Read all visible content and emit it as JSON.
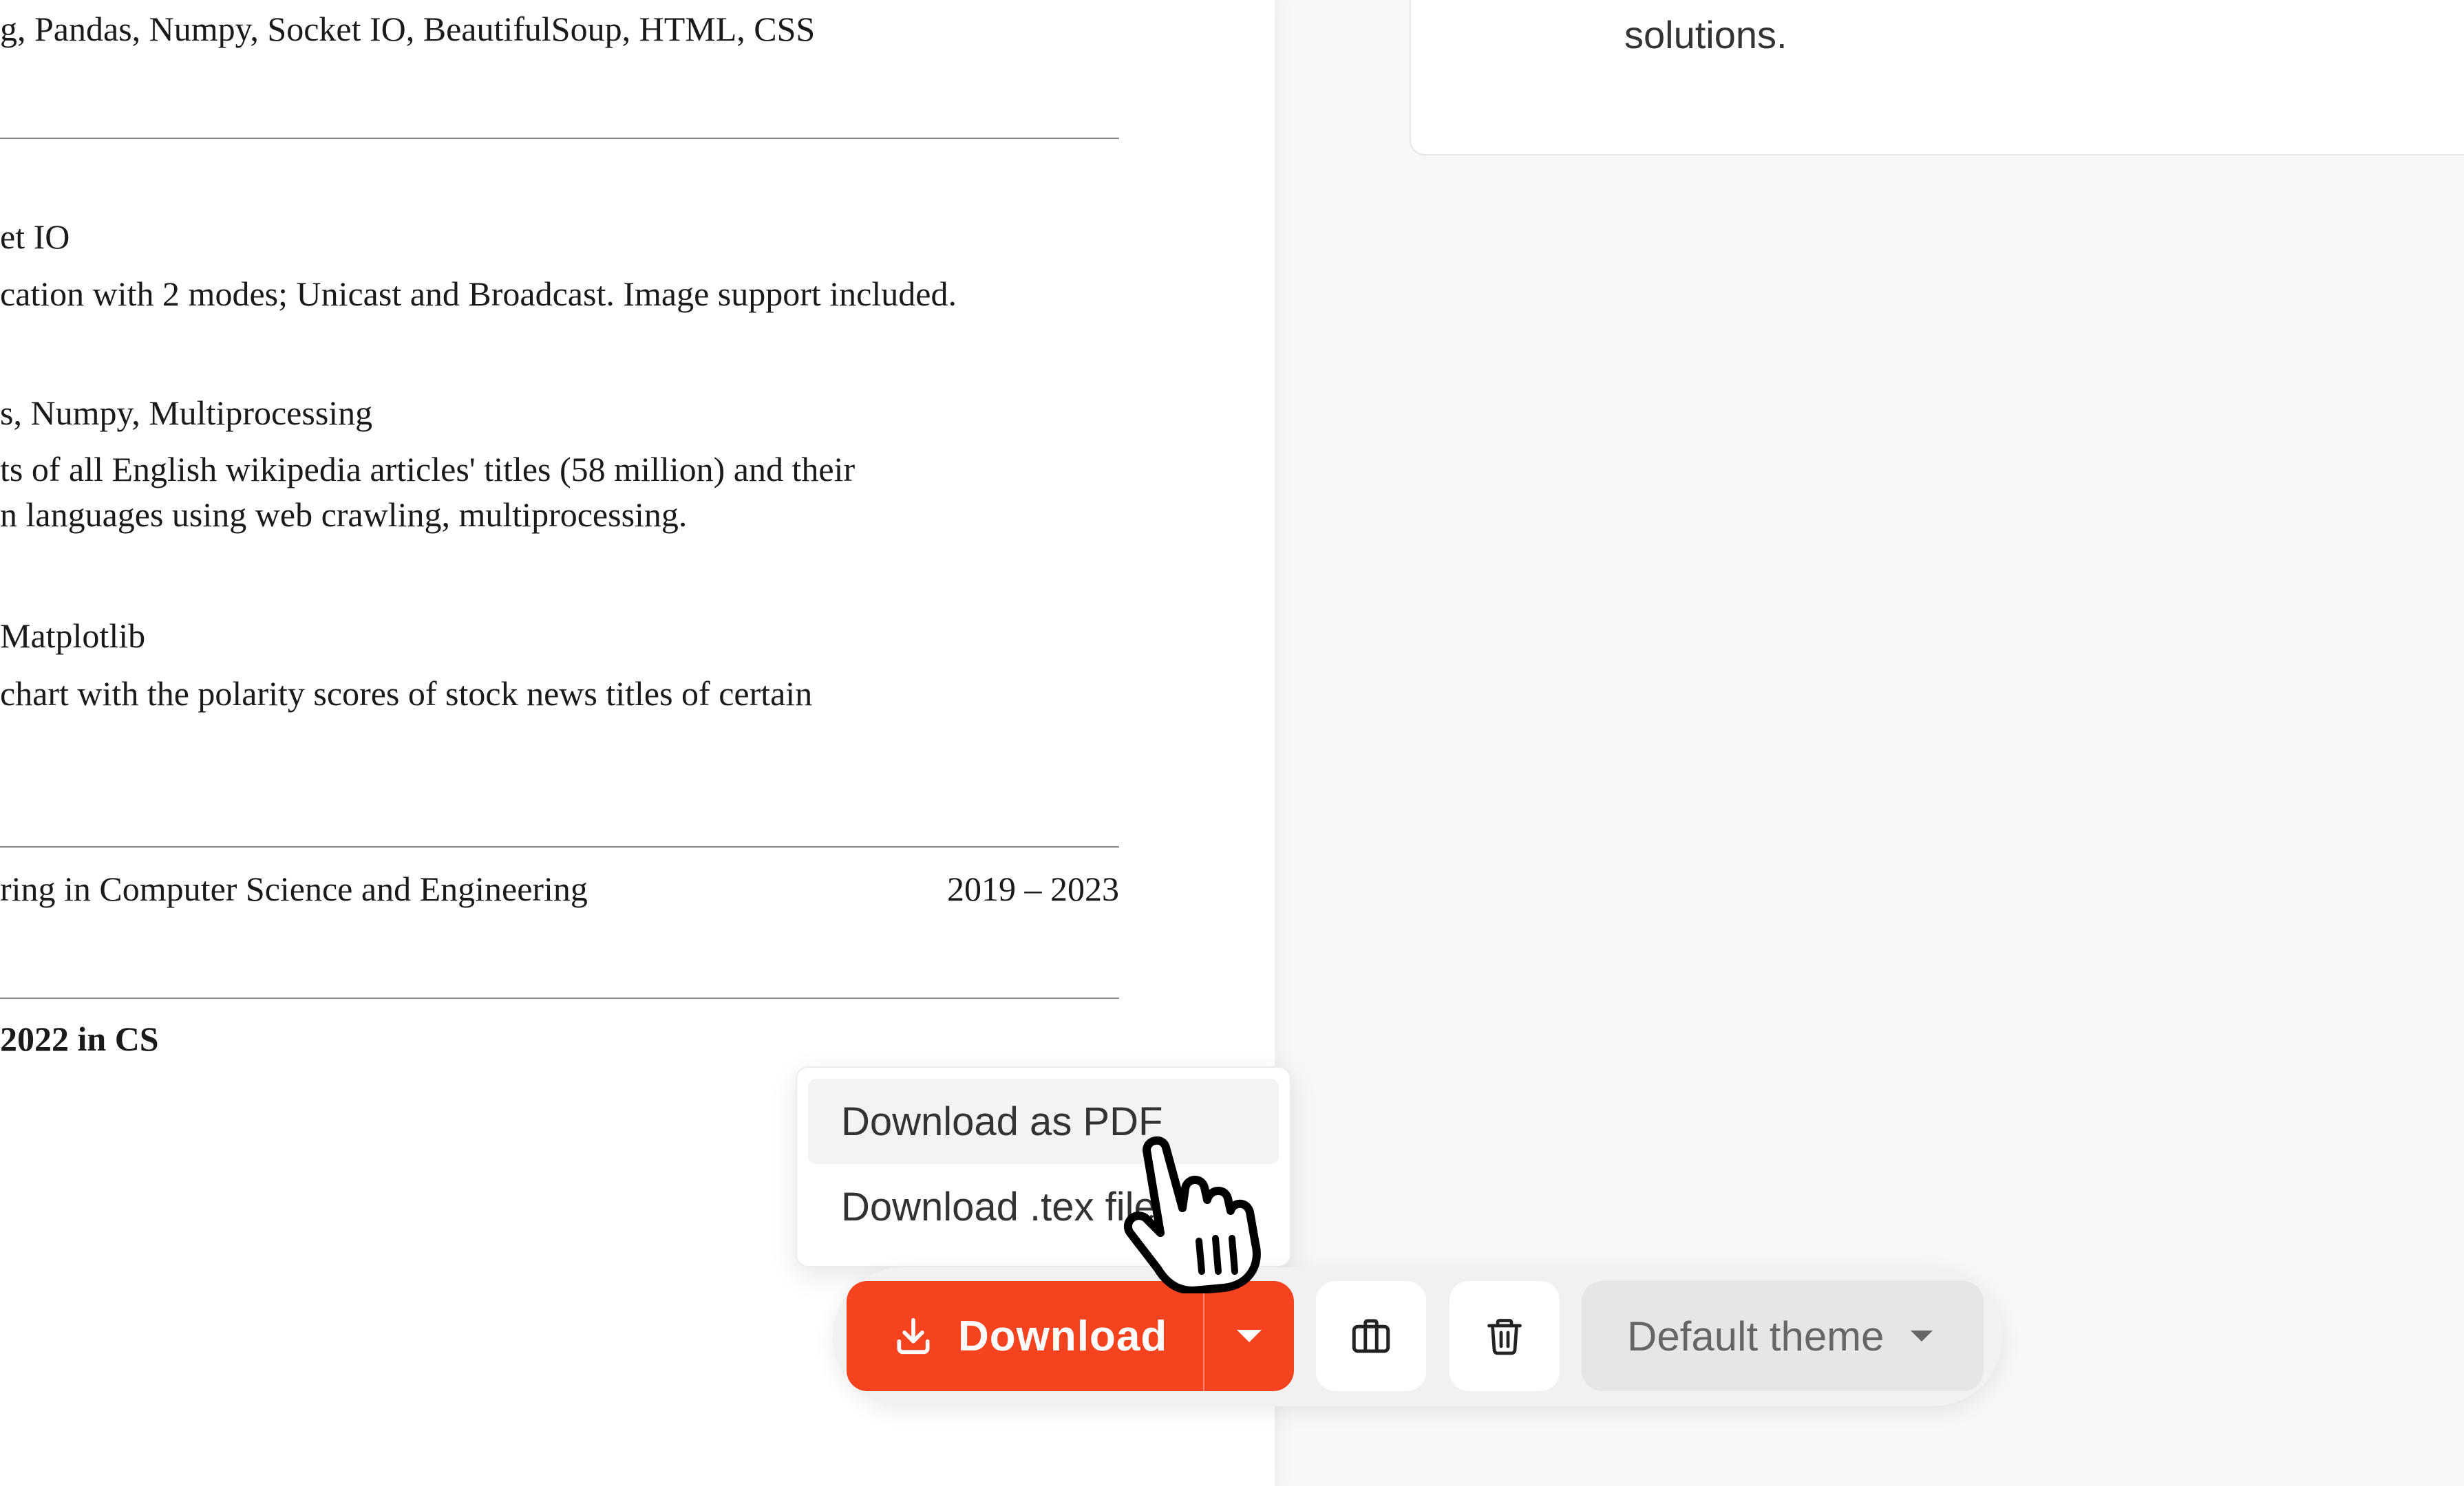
{
  "document": {
    "skills_line": "g, Pandas, Numpy, Socket IO, BeautifulSoup, HTML, CSS",
    "project1_tech": "et IO",
    "project1_desc": "cation with 2 modes; Unicast and Broadcast. Image support included.",
    "project2_tech": "s, Numpy, Multiprocessing",
    "project2_desc_line1": "ts of all English wikipedia articles' titles (58 million) and their",
    "project2_desc_line2": "n languages using web crawling, multiprocessing.",
    "project3_tech": "Matplotlib",
    "project3_desc": " chart with the polarity scores of stock news titles of certain",
    "education_degree": "ring in Computer Science and Engineering",
    "education_years": "2019 – 2023",
    "award": "2022 in CS"
  },
  "right_panel": {
    "card_text": "solutions."
  },
  "menu": {
    "items": [
      {
        "label": "Download as PDF"
      },
      {
        "label": "Download .tex file"
      }
    ]
  },
  "toolbar": {
    "download_label": "Download",
    "theme_label": "Default theme"
  },
  "colors": {
    "accent": "#f5421f",
    "panel_bg": "#f7f7f7"
  },
  "icons": {
    "download": "download-icon",
    "caret": "chevron-down-icon",
    "briefcase": "briefcase-icon",
    "trash": "trash-icon",
    "cursor": "hand-pointer-icon"
  }
}
